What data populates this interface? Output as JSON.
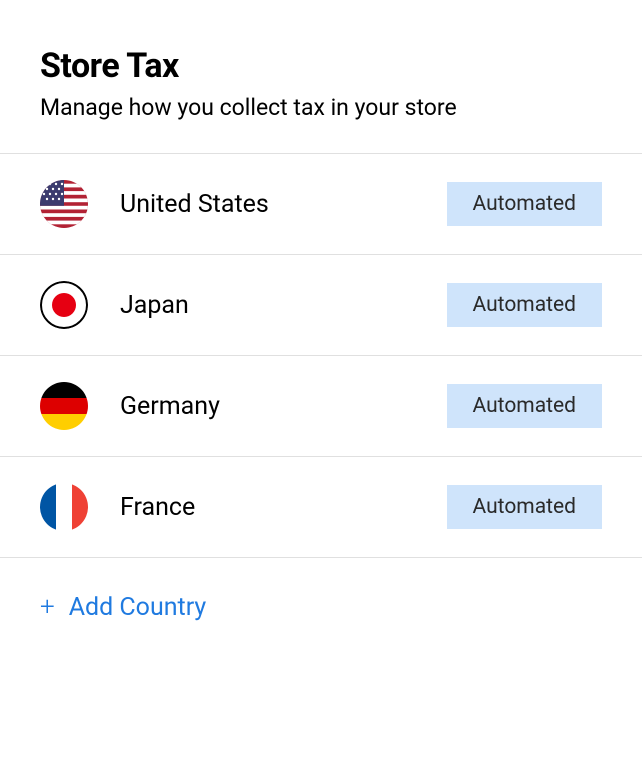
{
  "header": {
    "title": "Store Tax",
    "subtitle": "Manage how you collect tax in your store"
  },
  "countries": [
    {
      "name": "United States",
      "status": "Automated",
      "flag": "us"
    },
    {
      "name": "Japan",
      "status": "Automated",
      "flag": "jp"
    },
    {
      "name": "Germany",
      "status": "Automated",
      "flag": "de"
    },
    {
      "name": "France",
      "status": "Automated",
      "flag": "fr"
    }
  ],
  "actions": {
    "add_plus": "+",
    "add_label": "Add Country"
  }
}
